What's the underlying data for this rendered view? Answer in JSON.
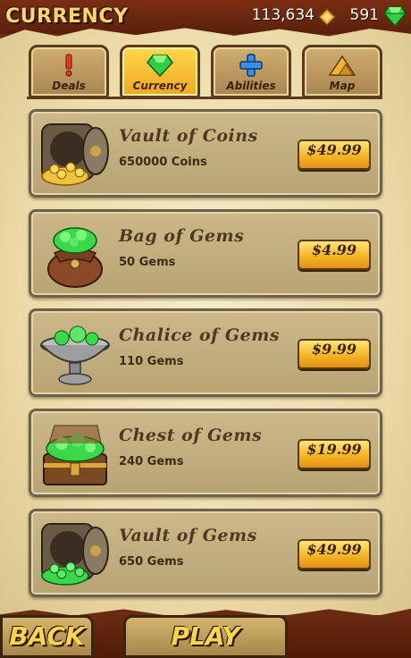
{
  "header": {
    "title": "CURRENCY",
    "coins": "113,634",
    "gems": "591",
    "coin_icon": "gold-diamond-icon",
    "gem_icon": "green-gem-icon"
  },
  "tabs": [
    {
      "label": "Deals",
      "icon": "exclamation-icon",
      "active": false
    },
    {
      "label": "Currency",
      "icon": "green-gem-icon",
      "active": true
    },
    {
      "label": "Abilities",
      "icon": "blue-plus-icon",
      "active": false
    },
    {
      "label": "Map",
      "icon": "mountain-icon",
      "active": false
    }
  ],
  "items": [
    {
      "title": "Vault of Coins",
      "subtitle": "650000 Coins",
      "price": "$49.99",
      "image": "vault-coins-image"
    },
    {
      "title": "Bag of Gems",
      "subtitle": "50 Gems",
      "price": "$4.99",
      "image": "gem-bag-image"
    },
    {
      "title": "Chalice of Gems",
      "subtitle": "110 Gems",
      "price": "$9.99",
      "image": "gem-chalice-image"
    },
    {
      "title": "Chest of Gems",
      "subtitle": "240 Gems",
      "price": "$19.99",
      "image": "gem-chest-image"
    },
    {
      "title": "Vault of Gems",
      "subtitle": "650 Gems",
      "price": "$49.99",
      "image": "vault-gems-image"
    }
  ],
  "footer": {
    "back_label": "BACK",
    "play_label": "PLAY"
  },
  "colors": {
    "accent_gold": "#f4b21e",
    "header_red": "#6b2a12",
    "parchment": "#ecdcaa",
    "gem_green": "#39d94a"
  }
}
